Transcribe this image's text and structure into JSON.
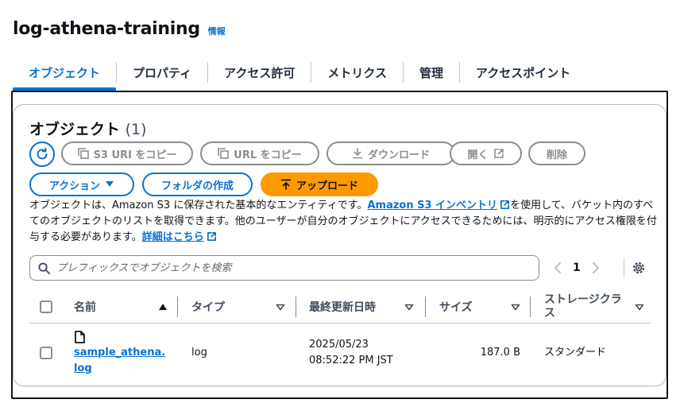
{
  "header": {
    "title": "log-athena-training",
    "info_label": "情報"
  },
  "tabs": [
    {
      "label": "オブジェクト",
      "active": true
    },
    {
      "label": "プロパティ"
    },
    {
      "label": "アクセス許可"
    },
    {
      "label": "メトリクス"
    },
    {
      "label": "管理"
    },
    {
      "label": "アクセスポイント"
    }
  ],
  "objects": {
    "title": "オブジェクト",
    "count": "(1)",
    "toolbar": {
      "refresh_icon": "refresh-icon",
      "copy_s3_uri": "S3 URI をコピー",
      "copy_url": "URL をコピー",
      "download": "ダウンロード",
      "open": "開く",
      "delete": "削除",
      "actions": "アクション",
      "create_folder": "フォルダの作成",
      "upload": "アップロード"
    },
    "description": {
      "text1": "オブジェクトは、Amazon S3 に保存された基本的なエンティティです。",
      "link1": "Amazon S3 インベントリ",
      "text2": "を使用して、バケット内のすべてのオブジェクトのリストを取得できます。他のユーザーが自分のオブジェクトにアクセスできるためには、明示的にアクセス権限を付与する必要があります。",
      "link2": "詳細はこちら"
    },
    "search": {
      "placeholder": "プレフィックスでオブジェクトを検索",
      "value": ""
    },
    "pagination": {
      "current_page": "1"
    },
    "columns": {
      "name": "名前",
      "type": "タイプ",
      "last_modified": "最終更新日時",
      "size": "サイズ",
      "storage_class": "ストレージクラス"
    },
    "rows": [
      {
        "name": "sample_athena.log",
        "type": "log",
        "date": "2025/05/23",
        "time": "08:52:22 PM JST",
        "size": "187.0 B",
        "storage_class": "スタンダード",
        "icon": "file-icon"
      }
    ]
  },
  "colors": {
    "accent": "#0972d3",
    "upload_button": "#ff9900",
    "disabled": "#8c8c94"
  }
}
